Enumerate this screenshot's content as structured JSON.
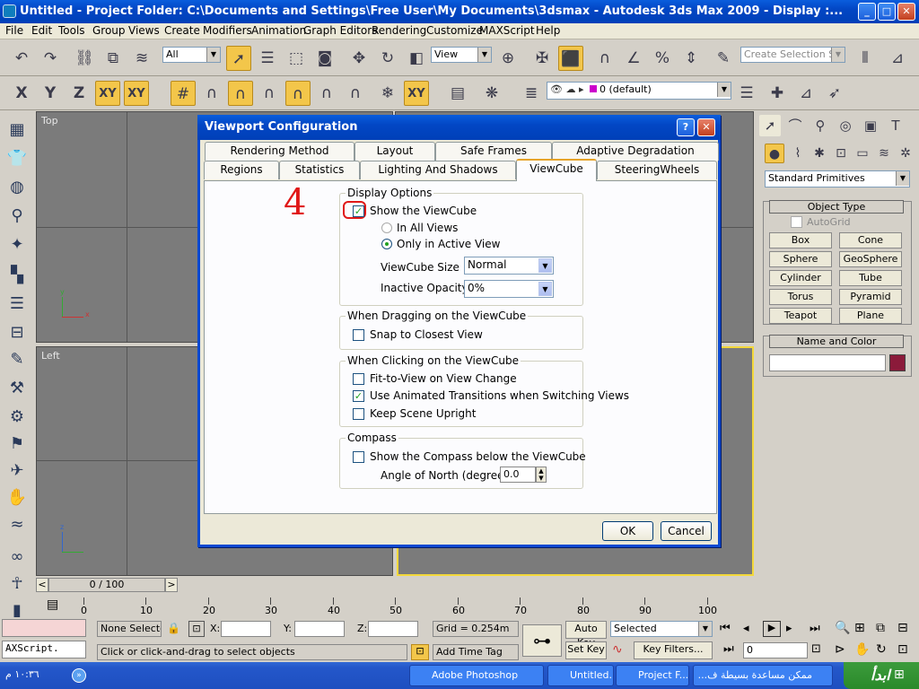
{
  "window": {
    "title": "Untitled    - Project Folder: C:\\Documents and Settings\\Free User\\My Documents\\3dsmax     - Autodesk 3ds Max  2009     - Display :...",
    "minimize": "_",
    "maximize": "□",
    "close": "✕"
  },
  "menu": [
    "File",
    "Edit",
    "Tools",
    "Group",
    "Views",
    "Create",
    "Modifiers",
    "Animation",
    "Graph Editors",
    "Rendering",
    "Customize",
    "MAXScript",
    "Help"
  ],
  "toolbar": {
    "filter_value": "All",
    "ref_coord_value": "View",
    "named_selection_placeholder": "Create Selection Set",
    "layer_value": "0 (default)",
    "axis_x": "X",
    "axis_y": "Y",
    "axis_z": "Z",
    "axis_xy": "XY",
    "axis_xy2": "XY"
  },
  "viewports": {
    "top_label": "Top",
    "left_label": "Left",
    "axis_x": "x",
    "axis_y": "y",
    "axis_z": "z"
  },
  "dialog": {
    "title": "Viewport Configuration",
    "help": "?",
    "close": "✕",
    "tabs_row1": [
      "Rendering Method",
      "Layout",
      "Safe Frames",
      "Adaptive Degradation"
    ],
    "tabs_row2": [
      "Regions",
      "Statistics",
      "Lighting And Shadows",
      "ViewCube",
      "SteeringWheels"
    ],
    "active_tab": "ViewCube",
    "annotation": "4",
    "display_options": {
      "title": "Display Options",
      "show_viewcube": "Show the ViewCube",
      "show_viewcube_checked": true,
      "in_all_views": "In All Views",
      "only_active": "Only in Active View",
      "size_label": "ViewCube Size",
      "size_value": "Normal",
      "opacity_label": "Inactive Opacity",
      "opacity_value": "0%"
    },
    "dragging": {
      "title": "When Dragging on the ViewCube",
      "snap": "Snap to Closest View"
    },
    "clicking": {
      "title": "When Clicking on the ViewCube",
      "fit": "Fit-to-View on View Change",
      "animated": "Use Animated Transitions when Switching Views",
      "upright": "Keep Scene Upright"
    },
    "compass": {
      "title": "Compass",
      "show": "Show the Compass below the ViewCube",
      "north_label": "Angle of North (degrees):",
      "north_value": "0.0"
    },
    "ok": "OK",
    "cancel": "Cancel"
  },
  "command_panel": {
    "category_value": "Standard Primitives",
    "object_type_title": "Object Type",
    "autogrid": "AutoGrid",
    "primitives": [
      "Box",
      "Cone",
      "Sphere",
      "GeoSphere",
      "Cylinder",
      "Tube",
      "Torus",
      "Pyramid",
      "Teapot",
      "Plane"
    ],
    "name_color_title": "Name and Color",
    "object_color": "#8b1a3a"
  },
  "timeline": {
    "frame_counter": "0 / 100",
    "prev": "<",
    "next": ">",
    "ticks": [
      "0",
      "10",
      "20",
      "30",
      "40",
      "50",
      "60",
      "70",
      "80",
      "90",
      "100"
    ]
  },
  "status": {
    "maxscript": "AXScript.",
    "selection": "None Selecte",
    "x_label": "X:",
    "y_label": "Y:",
    "z_label": "Z:",
    "grid": "Grid = 0.254m",
    "prompt": "Click or click-and-drag to select objects",
    "add_time_tag": "Add Time Tag",
    "auto_key": "Auto Key",
    "set_key": "Set Key",
    "key_mode_value": "Selected",
    "key_filters": "Key Filters...",
    "current_frame": "0"
  },
  "taskbar": {
    "clock": "١٠:٣٦ م",
    "tasks": [
      "Adobe Photoshop",
      "Untitled...",
      "Project F...",
      "ممكن مساعدة بسيطة ف..."
    ]
  }
}
